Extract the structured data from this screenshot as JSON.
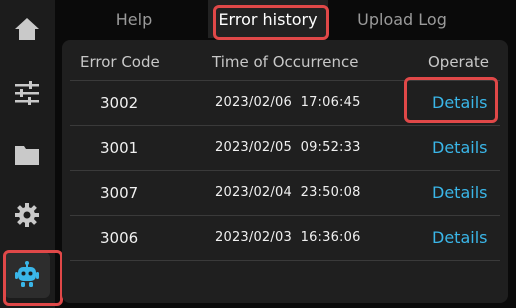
{
  "colors": {
    "background": "#0a0a0a",
    "sidebar": "#1c1c1c",
    "panel": "#1f1f1f",
    "link": "#3ab6e8",
    "highlight": "#e04848",
    "active_icon": "#3ab6e8"
  },
  "sidebar": {
    "items": [
      {
        "icon": "home-icon"
      },
      {
        "icon": "sliders-icon"
      },
      {
        "icon": "folder-icon"
      },
      {
        "icon": "gear-icon"
      },
      {
        "icon": "robot-icon",
        "active": true
      }
    ]
  },
  "tabs": [
    {
      "label": "Help"
    },
    {
      "label": "Error history",
      "active": true
    },
    {
      "label": "Upload Log"
    }
  ],
  "table": {
    "headers": {
      "code": "Error Code",
      "time": "Time of Occurrence",
      "operate": "Operate"
    },
    "rows": [
      {
        "code": "3002",
        "time": "2023/02/06  17:06:45",
        "action": "Details"
      },
      {
        "code": "3001",
        "time": "2023/02/05  09:52:33",
        "action": "Details"
      },
      {
        "code": "3007",
        "time": "2023/02/04  23:50:08",
        "action": "Details"
      },
      {
        "code": "3006",
        "time": "2023/02/03  16:36:06",
        "action": "Details"
      }
    ]
  }
}
